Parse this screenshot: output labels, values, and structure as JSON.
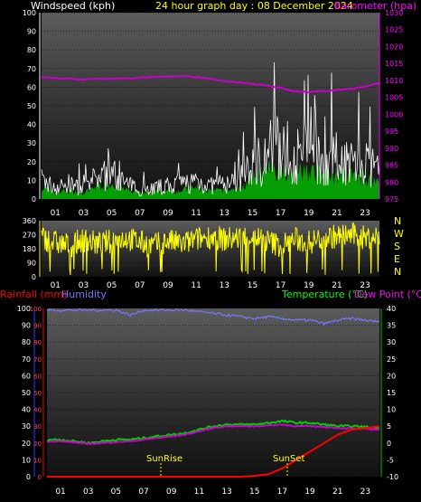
{
  "top_panel": {
    "left_title": "Windspeed (kph)",
    "center_title": "24 hour graph day : 08 December 2024",
    "right_title": "Barometer (hpa)",
    "left_ticks": [
      "0",
      "10",
      "20",
      "30",
      "40",
      "50",
      "60",
      "70",
      "80",
      "90",
      "100"
    ],
    "right_ticks": [
      "975",
      "980",
      "985",
      "990",
      "995",
      "1000",
      "1005",
      "1010",
      "1015",
      "1020",
      "1025",
      "1030"
    ],
    "hour_ticks": [
      "01",
      "03",
      "05",
      "07",
      "09",
      "11",
      "13",
      "15",
      "17",
      "19",
      "21",
      "23"
    ]
  },
  "middle_panel": {
    "left_ticks": [
      "0",
      "90",
      "180",
      "270",
      "360"
    ],
    "compass_labels": [
      "N",
      "W",
      "S",
      "E",
      "N"
    ],
    "hour_ticks": [
      "01",
      "03",
      "05",
      "07",
      "09",
      "11",
      "13",
      "15",
      "17",
      "19",
      "21",
      "23"
    ]
  },
  "bottom_panel": {
    "title_rainfall": "Rainfall (mm)",
    "title_humidity": "Humidity",
    "title_temperature": "Temperature (°C)",
    "title_dewpoint": "Dew Point (°C)",
    "left_ticks": [
      "0",
      "10",
      "20",
      "30",
      "40",
      "50",
      "60",
      "70",
      "80",
      "90",
      "100"
    ],
    "right_ticks": [
      "-10",
      "-5",
      "0",
      "5",
      "10",
      "15",
      "20",
      "25",
      "30",
      "35",
      "40"
    ],
    "hour_ticks": [
      "01",
      "03",
      "05",
      "07",
      "09",
      "11",
      "13",
      "15",
      "17",
      "19",
      "21",
      "23"
    ],
    "sunrise_label": "SunRise",
    "sunset_label": "SunSet"
  },
  "colors": {
    "wind": "#ffffff",
    "gust_area": "#00cc00",
    "barometer": "#cc00cc",
    "wind_dir": "#ffff00",
    "humidity": "#7777ff",
    "temperature": "#00cc00",
    "dewpoint": "#cc00cc",
    "rainfall": "#ff0000",
    "title_left": "#ffffff",
    "title_center": "#ffff00",
    "title_right": "#ff00ff",
    "title_rain": "#ff0000",
    "title_humidity": "#7777ff",
    "title_temp": "#00ff00",
    "title_dew": "#ff00ff"
  },
  "chart_data": [
    {
      "type": "line",
      "ylabel": "Windspeed (kph)",
      "y2label": "Barometer (hpa)",
      "ylim": [
        0,
        100
      ],
      "y2lim": [
        975,
        1030
      ],
      "x": [
        0,
        1,
        2,
        3,
        4,
        5,
        6,
        7,
        8,
        9,
        10,
        11,
        12,
        13,
        14,
        15,
        16,
        17,
        18,
        19,
        20,
        21,
        22,
        23,
        24
      ],
      "series": [
        {
          "name": "Windspeed",
          "values": [
            10,
            6,
            8,
            5,
            12,
            14,
            8,
            5,
            6,
            7,
            8,
            10,
            7,
            8,
            9,
            18,
            25,
            28,
            22,
            25,
            20,
            22,
            20,
            18,
            15
          ]
        },
        {
          "name": "Barometer",
          "values": [
            1011,
            1010.8,
            1010.5,
            1010.3,
            1010.4,
            1010.5,
            1010.6,
            1010.8,
            1011,
            1011.2,
            1011.3,
            1011.0,
            1010.5,
            1009.8,
            1009.4,
            1009,
            1008.5,
            1007.8,
            1006.8,
            1006.5,
            1006.8,
            1007.2,
            1007.5,
            1008.2,
            1009.2
          ]
        }
      ]
    },
    {
      "type": "line",
      "ylabel": "",
      "ylim": [
        0,
        360
      ],
      "x": [
        0,
        1,
        2,
        3,
        4,
        5,
        6,
        7,
        8,
        9,
        10,
        11,
        12,
        13,
        14,
        15,
        16,
        17,
        18,
        19,
        20,
        21,
        22,
        23,
        24
      ],
      "series": [
        {
          "name": "Wind direction",
          "values": [
            250,
            220,
            200,
            240,
            210,
            230,
            250,
            220,
            200,
            230,
            210,
            240,
            260,
            240,
            250,
            260,
            230,
            200,
            240,
            220,
            250,
            260,
            270,
            250,
            260
          ]
        }
      ]
    },
    {
      "type": "line",
      "ylabel": "Rainfall (mm)",
      "y2label": "Temperature (°C)",
      "ylim": [
        0,
        100
      ],
      "y2lim": [
        -10,
        40
      ],
      "x": [
        0,
        1,
        2,
        3,
        4,
        5,
        6,
        7,
        8,
        9,
        10,
        11,
        12,
        13,
        14,
        15,
        16,
        17,
        18,
        19,
        20,
        21,
        22,
        23,
        24
      ],
      "series": [
        {
          "name": "Humidity",
          "values": [
            99,
            99,
            99,
            99,
            99,
            99,
            96,
            99,
            99,
            99,
            99,
            98,
            97,
            96,
            95,
            94,
            95,
            94,
            93,
            93,
            91,
            93,
            94,
            93,
            92
          ]
        },
        {
          "name": "Temperature",
          "values": [
            1,
            1,
            0.5,
            0,
            0.5,
            1,
            1,
            1.5,
            2,
            2.5,
            3,
            4,
            5,
            5.5,
            5.5,
            5.5,
            6,
            6.5,
            6,
            6,
            5.5,
            5,
            5,
            4.8,
            4.5
          ]
        },
        {
          "name": "Dew Point",
          "values": [
            0.5,
            0.5,
            0.2,
            -0.2,
            0,
            0.3,
            0.5,
            1,
            1.5,
            2,
            2.5,
            3.5,
            4.5,
            5,
            5,
            5,
            5.2,
            5.5,
            5,
            5,
            4.8,
            4.5,
            4.3,
            4.2,
            4
          ]
        },
        {
          "name": "Rainfall",
          "values": [
            0,
            0,
            0,
            0,
            0,
            0,
            0,
            0,
            0,
            0,
            0,
            0,
            0,
            0,
            0,
            0.5,
            1.5,
            5,
            10,
            15,
            20,
            25,
            28,
            29,
            30
          ]
        }
      ]
    }
  ]
}
